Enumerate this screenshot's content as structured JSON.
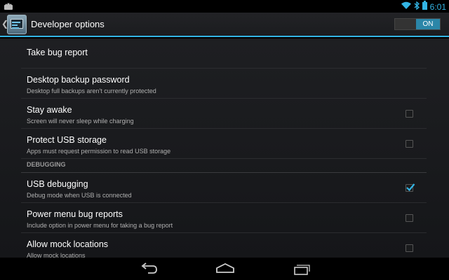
{
  "status_bar": {
    "time": "6:01",
    "notification_icon": "android-icon",
    "wifi_icon": "wifi-icon",
    "bluetooth_icon": "bluetooth-icon",
    "battery_icon": "battery-icon"
  },
  "action_bar": {
    "title": "Developer options",
    "toggle_label": "ON",
    "accent_color": "#33b5e5"
  },
  "preferences": {
    "take_bug_report": {
      "title": "Take bug report"
    },
    "desktop_backup_password": {
      "title": "Desktop backup password",
      "summary": "Desktop full backups aren't currently protected"
    },
    "stay_awake": {
      "title": "Stay awake",
      "summary": "Screen will never sleep while charging",
      "checked": false
    },
    "protect_usb_storage": {
      "title": "Protect USB storage",
      "summary": "Apps must request permission to read USB storage",
      "checked": false
    },
    "debugging_header": "DEBUGGING",
    "usb_debugging": {
      "title": "USB debugging",
      "summary": "Debug mode when USB is connected",
      "checked": true
    },
    "power_menu_bug_reports": {
      "title": "Power menu bug reports",
      "summary": "Include option in power menu for taking a bug report",
      "checked": false
    },
    "allow_mock_locations": {
      "title": "Allow mock locations",
      "summary": "Allow mock locations",
      "checked": false
    }
  },
  "nav_bar": {
    "back_icon": "back-icon",
    "home_icon": "home-icon",
    "recents_icon": "recent-apps-icon"
  }
}
